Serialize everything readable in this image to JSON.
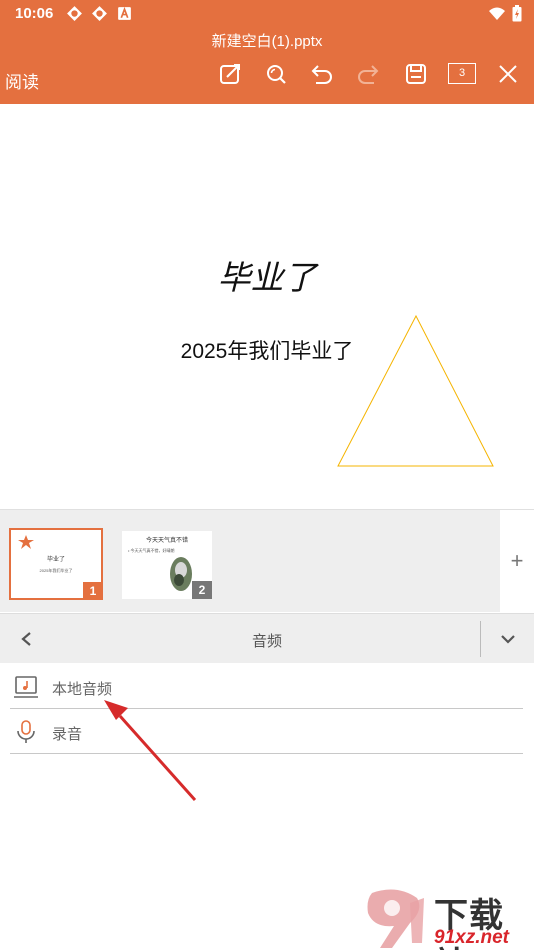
{
  "status_bar": {
    "time": "10:06"
  },
  "toolbar": {
    "doc_title": "新建空白(1).pptx",
    "mode_label": "阅读",
    "page_count": "3"
  },
  "slide": {
    "title": "毕业了",
    "subtitle": "2025年我们毕业了"
  },
  "thumbnails": [
    {
      "number": "1",
      "title": "毕业了",
      "subtitle": "2025年我们毕业了"
    },
    {
      "number": "2",
      "title": "今天天气真不错",
      "bullet": "• 今天天气真不错，好晴朗"
    }
  ],
  "add_slide_label": "+",
  "panel": {
    "title": "音频",
    "options": [
      {
        "label": "本地音频",
        "icon": "music-file-icon"
      },
      {
        "label": "录音",
        "icon": "microphone-icon"
      }
    ]
  },
  "watermark": {
    "line1": "下载站",
    "line2": "91xz.net"
  },
  "colors": {
    "accent": "#e4703f",
    "annotation_arrow": "#d62b2b",
    "triangle": "#f5b400"
  }
}
